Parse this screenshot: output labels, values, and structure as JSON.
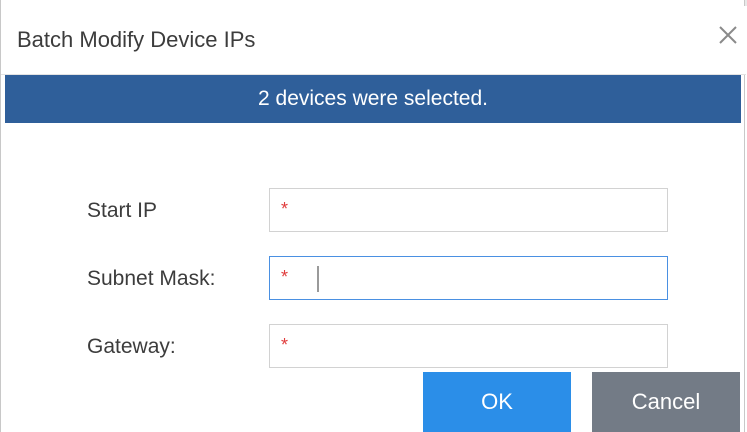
{
  "dialog": {
    "title": "Batch Modify Device IPs",
    "close_icon": "close-icon",
    "banner_text": "2 devices were selected."
  },
  "form": {
    "start_ip": {
      "label": "Start IP",
      "value": "",
      "required_mark": "*"
    },
    "subnet_mask": {
      "label": "Subnet Mask:",
      "value": "",
      "required_mark": "*"
    },
    "gateway": {
      "label": "Gateway:",
      "value": "",
      "required_mark": "*"
    }
  },
  "buttons": {
    "ok": "OK",
    "cancel": "Cancel"
  },
  "colors": {
    "banner": "#2f5f9a",
    "ok_button": "#2b8ee8",
    "cancel_button": "#737b86",
    "required_mark": "#e03c3c",
    "focus_border": "#4a90e2"
  }
}
